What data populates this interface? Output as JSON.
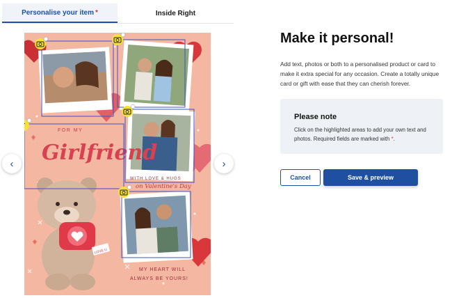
{
  "tabs": [
    {
      "label": "Personalise your item",
      "required_mark": "*",
      "active": true
    },
    {
      "label": "Inside Right",
      "active": false
    }
  ],
  "card": {
    "text_for_my": "FOR MY",
    "text_girlfriend": "Girlfriend",
    "text_with_love": "WITH LOVE & HUGS",
    "text_valentines": "on Valentine's Day",
    "text_heart_will": "MY HEART WILL",
    "text_always": "ALWAYS BE YOURS!",
    "tag_label": "LOVE U"
  },
  "icons": {
    "photo_edit": "camera-icon",
    "text_edit": "text-icon",
    "remove": "close-icon",
    "nav_prev": "chevron-left-icon",
    "nav_next": "chevron-right-icon"
  },
  "nav": {
    "prev": "‹",
    "next": "›"
  },
  "panel": {
    "heading": "Make it personal!",
    "description": "Add text, photos or both to a personalised product or card to make it extra special for any occasion. Create a totally unique card or gift with ease that they can cherish forever.",
    "note_title": "Please note",
    "note_text": "Click on the highlighted areas to add your own text and photos. Required fields are marked with",
    "note_required": "*",
    "note_end": "."
  },
  "buttons": {
    "cancel": "Cancel",
    "save": "Save & preview"
  },
  "colors": {
    "accent": "#1e4fa0",
    "card_bg": "#f4b7a2",
    "badge": "#f6e03a",
    "heart": "#d8383c",
    "required": "#d23a3a"
  }
}
